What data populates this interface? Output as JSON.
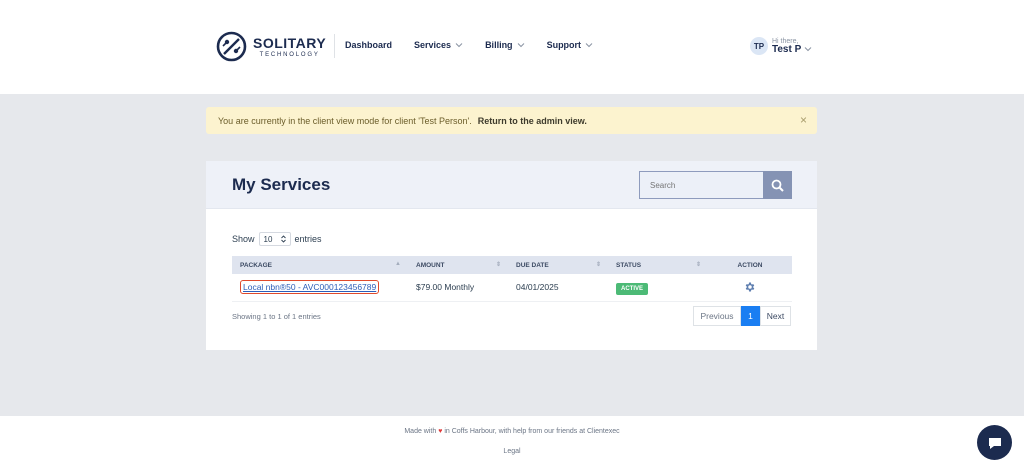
{
  "header": {
    "logo_name": "SOLITARY",
    "logo_sub": "TECHNOLOGY",
    "nav": [
      {
        "label": "Dashboard",
        "has_dropdown": false
      },
      {
        "label": "Services",
        "has_dropdown": true
      },
      {
        "label": "Billing",
        "has_dropdown": true
      },
      {
        "label": "Support",
        "has_dropdown": true
      }
    ],
    "user": {
      "initials": "TP",
      "greeting": "Hi there,",
      "name": "Test P"
    }
  },
  "alert": {
    "message": "You are currently in the client view mode for client 'Test Person'.",
    "link": "Return to the admin view.",
    "close": "×"
  },
  "services": {
    "title": "My Services",
    "search_placeholder": "Search",
    "show_label": "Show",
    "entries_value": "10",
    "entries_label": "entries",
    "columns": [
      "PACKAGE",
      "AMOUNT",
      "DUE DATE",
      "STATUS",
      "ACTION"
    ],
    "rows": [
      {
        "package": "Local nbn®50 - AVC000123456789",
        "amount": "$79.00 Monthly",
        "due_date": "04/01/2025",
        "status": "ACTIVE"
      }
    ],
    "info": "Showing 1 to 1 of 1 entries",
    "pager": {
      "previous": "Previous",
      "current": "1",
      "next": "Next"
    }
  },
  "footer": {
    "made_with": "Made with",
    "heart": "♥",
    "rest": "in Coffs Harbour, with help from our friends at Clientexec",
    "legal": "Legal"
  },
  "colors": {
    "brand": "#1c2b4f",
    "accent": "#1a7ef2",
    "status_active": "#4cba76",
    "alert_bg": "#fcf3cf"
  },
  "icons": [
    "logo-icon",
    "chevron-down-icon",
    "close-icon",
    "search-icon",
    "gear-icon",
    "chat-icon"
  ]
}
